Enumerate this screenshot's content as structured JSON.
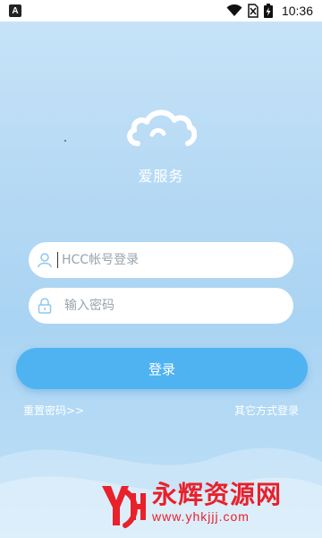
{
  "status_bar": {
    "notification_icon": "a-notification-icon",
    "wifi_icon": "wifi-icon",
    "sim_icon": "no-sim-icon",
    "battery_icon": "battery-charging-icon",
    "time": "10:36"
  },
  "brand": {
    "logo_icon": "cloud-icon",
    "title": "爱服务"
  },
  "account_field": {
    "icon": "user-icon",
    "placeholder": "HCC帐号登录",
    "value": ""
  },
  "password_field": {
    "icon": "lock-icon",
    "placeholder": "输入密码",
    "value": ""
  },
  "login_button": {
    "label": "登录",
    "color": "#4fb3f2"
  },
  "links": {
    "reset_password": "重置密码>>",
    "other_login": "其它方式登录"
  },
  "watermark": {
    "logo_text": "YH",
    "name": "永辉资源网",
    "url": "www.yhkjjj.com",
    "color": "#e8212b"
  },
  "colors": {
    "background_top": "#c9e4f8",
    "background_bottom": "#aad4f3",
    "field_icon": "#8fc7ee"
  }
}
